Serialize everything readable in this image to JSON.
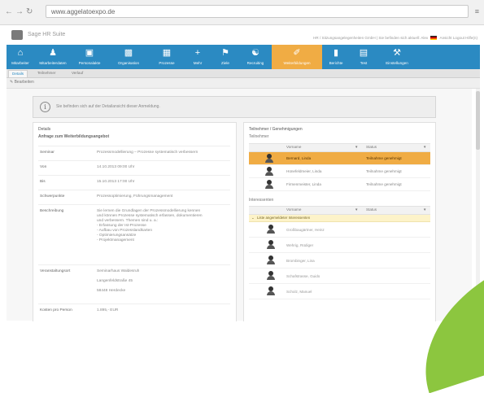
{
  "browser": {
    "url": "www.aggelatoexpo.de",
    "back_icon": "back-arrow-icon",
    "forward_icon": "forward-arrow-icon",
    "reload_icon": "reload-icon",
    "menu_icon": "menu-icon"
  },
  "app": {
    "title": "Sage HR Suite",
    "user_info": "HR / Sitzungsangelegenheiten GmbH | Sie befinden sich aktuell: Alex",
    "user_links": "Ansicht  Logout  Hilfe(n)"
  },
  "nav": {
    "items": [
      {
        "label": "Mitarbeiter",
        "icon": "home-icon"
      },
      {
        "label": "Mitarbeiterdaten",
        "icon": "person-icon"
      },
      {
        "label": "Personalakte",
        "icon": "document-icon"
      },
      {
        "label": "Organisation",
        "icon": "org-icon"
      },
      {
        "label": "Prozesse",
        "icon": "calendar-icon"
      },
      {
        "label": "Mehr",
        "icon": "plus-icon"
      },
      {
        "label": "Ziele",
        "icon": "flag-icon"
      },
      {
        "label": "Recruiting",
        "icon": "people-icon"
      },
      {
        "label": "Weiterbildungen",
        "icon": "training-icon",
        "active": true
      },
      {
        "label": "Berichte",
        "icon": "chart-icon"
      },
      {
        "label": "Test",
        "icon": "book-icon"
      },
      {
        "label": "Einstellungen",
        "icon": "wrench-icon"
      }
    ]
  },
  "subtabs": [
    {
      "label": "Details",
      "active": true
    },
    {
      "label": "Teilnehmer",
      "active": false
    },
    {
      "label": "Verlauf",
      "active": false
    }
  ],
  "toolbar": {
    "edit_label": "Bearbeiten"
  },
  "info": {
    "text": "Sie befinden sich auf der Detailansicht dieser Anmeldung."
  },
  "details": {
    "title": "Details",
    "subtitle": "Anfrage zum Weiterbildungsangebot",
    "fields": [
      {
        "label": "Seminar",
        "value": "Prozessmodellierung – Prozesse systematisch verbessern"
      },
      {
        "label": "Von",
        "value": "14.10.2013 09:00 Uhr"
      },
      {
        "label": "Bis",
        "value": "15.10.2013 17:00 Uhr"
      },
      {
        "label": "Schwerpunkte",
        "value": "Prozessoptimierung, Führungsmanagement"
      },
      {
        "label": "Beschreibung",
        "value": "Sie lernen die Grundlagen der Prozessmodellierung kennen\nund können Prozesse systematisch erfassen, dokumentieren\nund verbessern. Themen sind u. a.:\n- Erfassung der Ist-Prozesse\n- Aufbau von Prozesslandkarten\n- Optimierungsansätze\n- Projektmanagement"
      },
      {
        "label": "Veranstaltungsort",
        "value": "Seminarhaus Waldesruh\n\nLangenfeldstraße 45\n\n58448 Herdecke"
      },
      {
        "label": "Kosten pro Person",
        "value": "1.895,- EUR"
      }
    ]
  },
  "approvals": {
    "title": "Teilnehmer / Genehmigungen",
    "subtitle": "Teilnehmer",
    "col_name": "Vorname",
    "col_status": "Status",
    "rows": [
      {
        "name": "Bernard, Linda",
        "status": "Teilnahme genehmigt",
        "selected": true
      },
      {
        "name": "Hünefeldmeier, Linda",
        "status": "Teilnahme genehmigt",
        "selected": false
      },
      {
        "name": "Firmenmeister, Linda",
        "status": "Teilnahme genehmigt",
        "selected": false
      }
    ]
  },
  "candidates": {
    "subtitle": "Interessenten",
    "col_name": "Vorname",
    "col_status": "Status",
    "group_label": "Liste angemeldeter Interessenten",
    "rows": [
      {
        "name": "Großbaugärtner, Heinz"
      },
      {
        "name": "Wehrig, Rüdiger"
      },
      {
        "name": "Brombinger, Lina"
      },
      {
        "name": "Schafstrasse, Guido"
      },
      {
        "name": "Scholz, Manuel"
      }
    ]
  }
}
